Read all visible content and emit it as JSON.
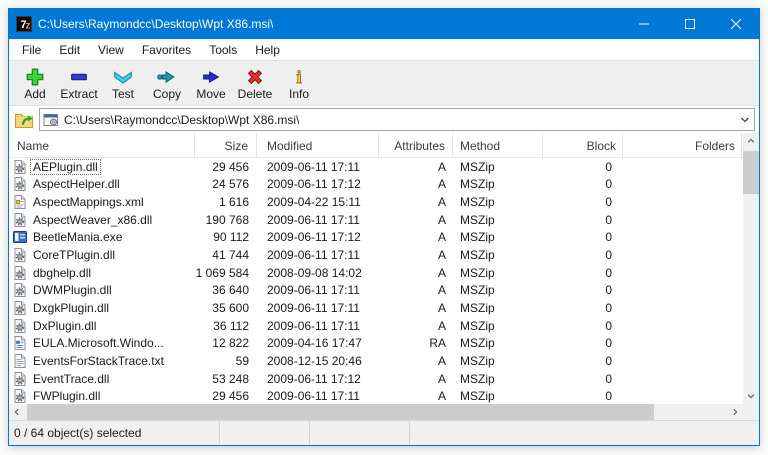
{
  "window": {
    "title": "C:\\Users\\Raymondcc\\Desktop\\Wpt X86.msi\\",
    "app_icon": "7z",
    "accent_color": "#0078d7"
  },
  "menu": {
    "items": [
      "File",
      "Edit",
      "View",
      "Favorites",
      "Tools",
      "Help"
    ]
  },
  "toolbar": {
    "buttons": [
      {
        "label": "Add",
        "icon": "add-plus-icon"
      },
      {
        "label": "Extract",
        "icon": "extract-minus-icon"
      },
      {
        "label": "Test",
        "icon": "test-check-icon"
      },
      {
        "label": "Copy",
        "icon": "copy-arrow-icon"
      },
      {
        "label": "Move",
        "icon": "move-arrow-icon"
      },
      {
        "label": "Delete",
        "icon": "delete-x-icon"
      },
      {
        "label": "Info",
        "icon": "info-i-icon"
      }
    ]
  },
  "address": {
    "path": "C:\\Users\\Raymondcc\\Desktop\\Wpt X86.msi\\",
    "icon": "msi-package-icon"
  },
  "list": {
    "columns": [
      {
        "label": "Name"
      },
      {
        "label": "Size"
      },
      {
        "label": "Modified"
      },
      {
        "label": "Attributes"
      },
      {
        "label": "Method"
      },
      {
        "label": "Block"
      },
      {
        "label": "Folders"
      }
    ],
    "rows": [
      {
        "name": "AEPlugin.dll",
        "icon": "dll-gear-icon",
        "size": "29 456",
        "modified": "2009-06-11 17:11",
        "attributes": "A",
        "method": "MSZip",
        "block": "0",
        "folders": "",
        "focused": true
      },
      {
        "name": "AspectHelper.dll",
        "icon": "dll-gear-icon",
        "size": "24 576",
        "modified": "2009-06-11 17:12",
        "attributes": "A",
        "method": "MSZip",
        "block": "0",
        "folders": ""
      },
      {
        "name": "AspectMappings.xml",
        "icon": "xml-doc-icon",
        "size": "1 616",
        "modified": "2009-04-22 15:11",
        "attributes": "A",
        "method": "MSZip",
        "block": "0",
        "folders": ""
      },
      {
        "name": "AspectWeaver_x86.dll",
        "icon": "dll-gear-icon",
        "size": "190 768",
        "modified": "2009-06-11 17:11",
        "attributes": "A",
        "method": "MSZip",
        "block": "0",
        "folders": ""
      },
      {
        "name": "BeetleMania.exe",
        "icon": "exe-app-icon",
        "size": "90 112",
        "modified": "2009-06-11 17:12",
        "attributes": "A",
        "method": "MSZip",
        "block": "0",
        "folders": ""
      },
      {
        "name": "CoreTPlugin.dll",
        "icon": "dll-gear-icon",
        "size": "41 744",
        "modified": "2009-06-11 17:11",
        "attributes": "A",
        "method": "MSZip",
        "block": "0",
        "folders": ""
      },
      {
        "name": "dbghelp.dll",
        "icon": "dll-gear-icon",
        "size": "1 069 584",
        "modified": "2008-09-08 14:02",
        "attributes": "A",
        "method": "MSZip",
        "block": "0",
        "folders": ""
      },
      {
        "name": "DWMPlugin.dll",
        "icon": "dll-gear-icon",
        "size": "36 640",
        "modified": "2009-06-11 17:11",
        "attributes": "A",
        "method": "MSZip",
        "block": "0",
        "folders": ""
      },
      {
        "name": "DxgkPlugin.dll",
        "icon": "dll-gear-icon",
        "size": "35 600",
        "modified": "2009-06-11 17:11",
        "attributes": "A",
        "method": "MSZip",
        "block": "0",
        "folders": ""
      },
      {
        "name": "DxPlugin.dll",
        "icon": "dll-gear-icon",
        "size": "36 112",
        "modified": "2009-06-11 17:11",
        "attributes": "A",
        "method": "MSZip",
        "block": "0",
        "folders": ""
      },
      {
        "name": "EULA.Microsoft.Windo...",
        "icon": "eula-doc-icon",
        "size": "12 822",
        "modified": "2009-04-16 17:47",
        "attributes": "RA",
        "method": "MSZip",
        "block": "0",
        "folders": ""
      },
      {
        "name": "EventsForStackTrace.txt",
        "icon": "txt-doc-icon",
        "size": "59",
        "modified": "2008-12-15 20:46",
        "attributes": "A",
        "method": "MSZip",
        "block": "0",
        "folders": ""
      },
      {
        "name": "EventTrace.dll",
        "icon": "dll-gear-icon",
        "size": "53 248",
        "modified": "2009-06-11 17:12",
        "attributes": "A",
        "method": "MSZip",
        "block": "0",
        "folders": ""
      },
      {
        "name": "FWPlugin.dll",
        "icon": "dll-gear-icon",
        "size": "29 456",
        "modified": "2009-06-11 17:11",
        "attributes": "A",
        "method": "MSZip",
        "block": "0",
        "folders": ""
      }
    ]
  },
  "status": {
    "text": "0 / 64 object(s) selected"
  }
}
